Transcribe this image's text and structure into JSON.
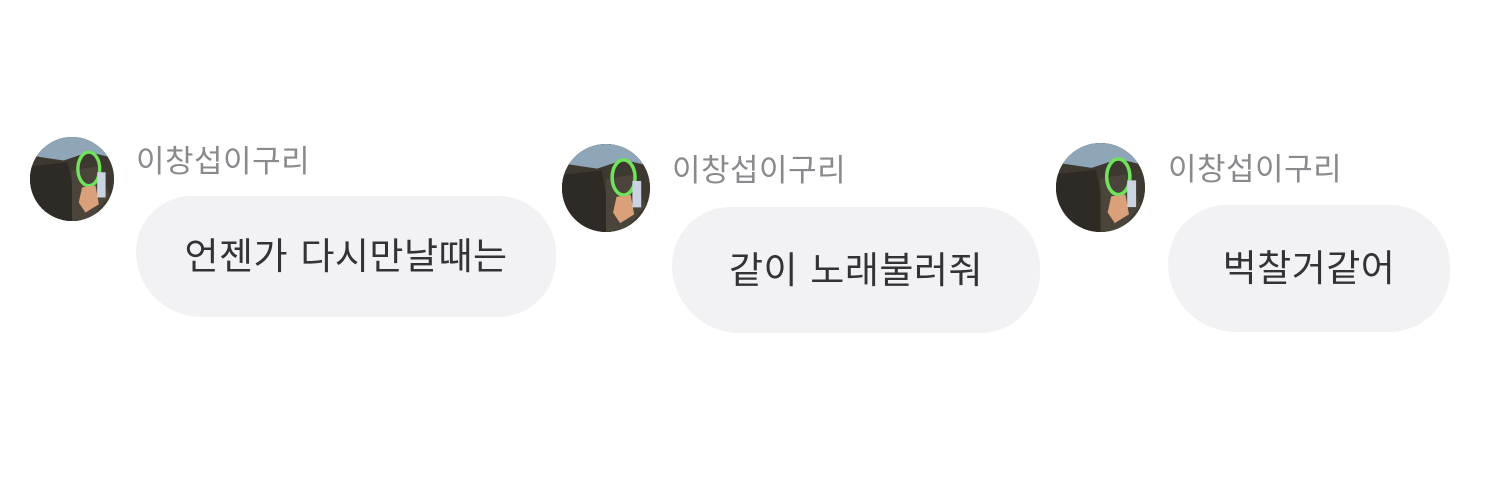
{
  "messages": [
    {
      "sender": "이창섭이구리",
      "text": "언젠가 다시만날때는",
      "avatar_icon": "profile-photo-icon"
    },
    {
      "sender": "이창섭이구리",
      "text": "같이 노래불러줘",
      "avatar_icon": "profile-photo-icon"
    },
    {
      "sender": "이창섭이구리",
      "text": "벅찰거같어",
      "avatar_icon": "profile-photo-icon"
    }
  ],
  "colors": {
    "background": "#ffffff",
    "bubble": "#f2f2f4",
    "sender_text": "#8a8a8e",
    "message_text": "#333336"
  }
}
